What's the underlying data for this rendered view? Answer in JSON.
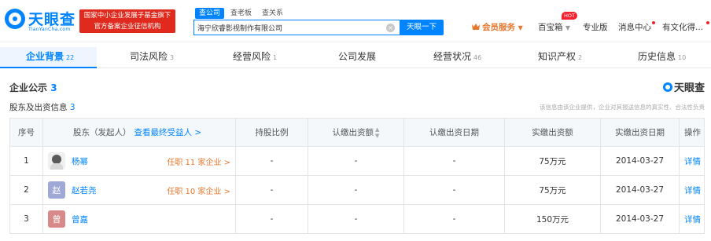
{
  "header": {
    "logo_text": "天眼查",
    "logo_sub": "TianYanCha.com",
    "gov_badge_line1": "国家中小企业发展子基金旗下",
    "gov_badge_line2": "官方备案企业征信机构",
    "search_tabs": [
      "查公司",
      "查老板",
      "查关系"
    ],
    "search_value": "海宁欣睿影视制作有限公司",
    "search_button": "天眼一下",
    "member": "会员服务",
    "baibao": "百宝箱",
    "hot": "HOT",
    "pro": "专业版",
    "msg": "消息中心",
    "user": "有文化得..."
  },
  "tabs": [
    {
      "label": "企业背景",
      "count": "22"
    },
    {
      "label": "司法风险",
      "count": "3"
    },
    {
      "label": "经营风险",
      "count": "1"
    },
    {
      "label": "公司发展",
      "count": ""
    },
    {
      "label": "经营状况",
      "count": "46"
    },
    {
      "label": "知识产权",
      "count": "2"
    },
    {
      "label": "历史信息",
      "count": "10"
    }
  ],
  "section": {
    "title": "企业公示",
    "title_count": "3",
    "watermark": "天眼查",
    "sub_title": "股东及出资信息",
    "sub_count": "3",
    "disclaimer": "该信息由该企业提供，企业对其报送信息的真实性、合法性负责"
  },
  "table": {
    "headers": {
      "seq": "序号",
      "holder": "股东（发起人）",
      "beneficiary_link": "查看最终受益人 >",
      "ratio": "持股比例",
      "sub_amount": "认缴出资额",
      "sub_date": "认缴出资日期",
      "paid_amount": "实缴出资额",
      "paid_date": "实缴出资日期",
      "op": "操作"
    },
    "rows": [
      {
        "seq": "1",
        "avatar": "",
        "name": "杨幂",
        "position": "任职 11 家企业 >",
        "ratio": "-",
        "sub_amount": "-",
        "sub_date": "-",
        "paid_amount": "75万元",
        "paid_date": "2014-03-27",
        "op": "详情"
      },
      {
        "seq": "2",
        "avatar": "赵",
        "name": "赵若尧",
        "position": "任职 10 家企业 >",
        "ratio": "-",
        "sub_amount": "-",
        "sub_date": "-",
        "paid_amount": "75万元",
        "paid_date": "2014-03-27",
        "op": "详情"
      },
      {
        "seq": "3",
        "avatar": "曾",
        "name": "曾嘉",
        "position": "",
        "ratio": "-",
        "sub_amount": "-",
        "sub_date": "-",
        "paid_amount": "150万元",
        "paid_date": "2014-03-27",
        "op": "详情"
      }
    ]
  }
}
